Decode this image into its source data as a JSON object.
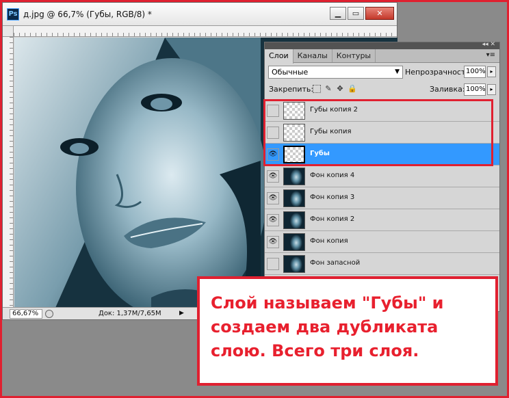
{
  "document": {
    "title": "д.jpg @ 66,7% (Губы, RGB/8) *",
    "app_icon": "Ps",
    "controls": [
      "minimize",
      "restore",
      "close"
    ],
    "control_glyphs": [
      "▁",
      "▭",
      "✕"
    ],
    "status": {
      "zoom": "66,67%",
      "doc_info": "Док: 1,37M/7,65M",
      "arrow": "▶"
    }
  },
  "layers_panel": {
    "tabs": [
      "Слои",
      "Каналы",
      "Контуры"
    ],
    "menu_glyph": "▾≡",
    "collapse_glyph": "◂◂ ✕",
    "blend_mode": "Обычные",
    "opacity_label": "Непрозрачность:",
    "opacity_value": "100%",
    "lock_label": "Закрепить:",
    "fill_label": "Заливка:",
    "fill_value": "100%",
    "dropdown_arrow": "▼",
    "spinner_arrow": "▸",
    "eye_glyph": "👁",
    "layers": [
      {
        "name": "Губы копия 2",
        "visible": false,
        "selected": false,
        "thumb": "transparent"
      },
      {
        "name": "Губы копия",
        "visible": false,
        "selected": false,
        "thumb": "transparent"
      },
      {
        "name": "Губы",
        "visible": true,
        "selected": true,
        "thumb": "transparent"
      },
      {
        "name": "Фон копия 4",
        "visible": true,
        "selected": false,
        "thumb": "image"
      },
      {
        "name": "Фон копия 3",
        "visible": true,
        "selected": false,
        "thumb": "image"
      },
      {
        "name": "Фон копия 2",
        "visible": true,
        "selected": false,
        "thumb": "image"
      },
      {
        "name": "Фон копия",
        "visible": true,
        "selected": false,
        "thumb": "image"
      },
      {
        "name": "Фон запасной",
        "visible": false,
        "selected": false,
        "thumb": "image"
      }
    ]
  },
  "callout": {
    "text": "Слой называем \"Губы\" и создаем два дубликата слою. Всего три слоя."
  },
  "colors": {
    "accent": "#e02030",
    "selection": "#3399ff"
  }
}
